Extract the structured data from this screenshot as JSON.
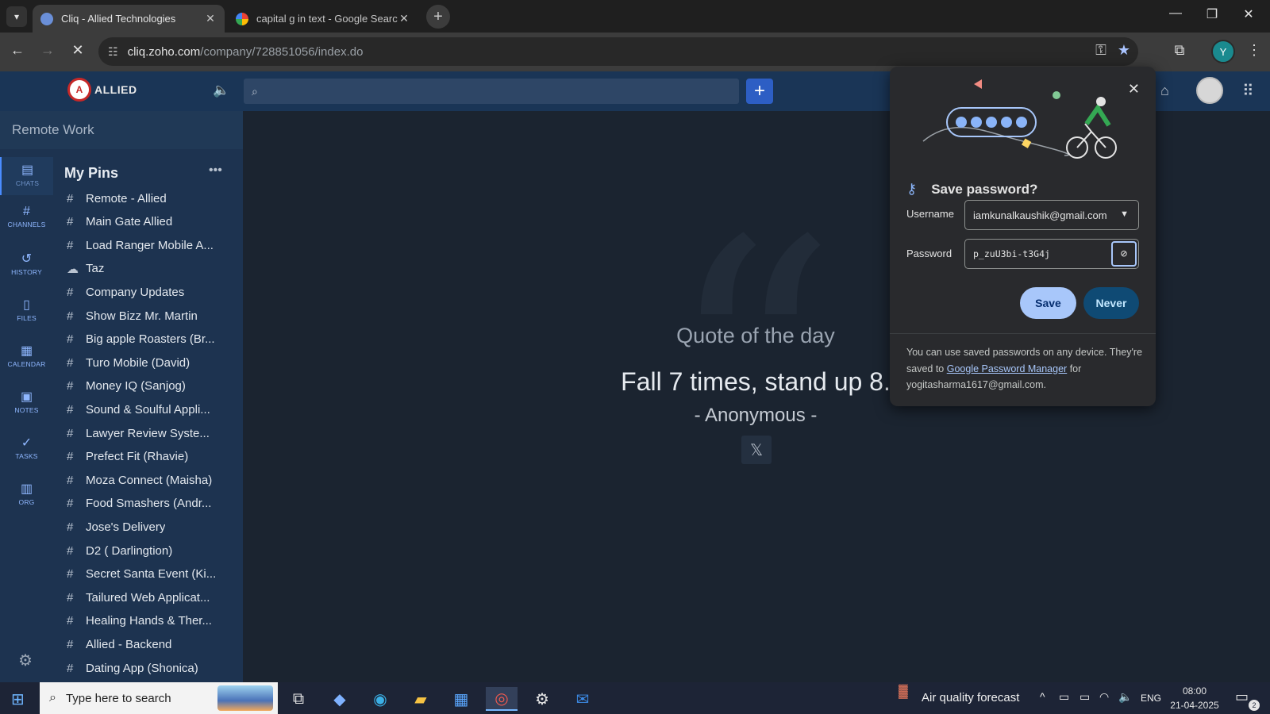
{
  "browser": {
    "tabs": [
      {
        "title": "Cliq - Allied Technologies",
        "active": true
      },
      {
        "title": "capital g in text - Google Search",
        "active": false
      }
    ],
    "url_host": "cliq.zoho.com",
    "url_path": "/company/728851056/index.do",
    "profile_initial": "Y"
  },
  "cliq": {
    "logo_text": "ALLIED",
    "org_name": "Remote Work",
    "rail": [
      {
        "label": "CHATS",
        "icon": "chat-icon"
      },
      {
        "label": "CHANNELS",
        "icon": "hash-icon"
      },
      {
        "label": "HISTORY",
        "icon": "history-icon"
      },
      {
        "label": "FILES",
        "icon": "file-icon"
      },
      {
        "label": "CALENDAR",
        "icon": "calendar-icon"
      },
      {
        "label": "NOTES",
        "icon": "notes-icon"
      },
      {
        "label": "TASKS",
        "icon": "tasks-icon"
      },
      {
        "label": "ORG",
        "icon": "org-icon"
      }
    ],
    "pins_title": "My Pins",
    "pins": [
      {
        "name": "Remote - Allied",
        "icon": "#"
      },
      {
        "name": "Main Gate Allied",
        "icon": "#"
      },
      {
        "name": "Load Ranger Mobile A...",
        "icon": "#"
      },
      {
        "name": "Taz",
        "icon": "cloud"
      },
      {
        "name": "Company Updates",
        "icon": "#"
      },
      {
        "name": "Show Bizz Mr. Martin",
        "icon": "#"
      },
      {
        "name": "Big apple Roasters (Br...",
        "icon": "#"
      },
      {
        "name": "Turo Mobile (David)",
        "icon": "#"
      },
      {
        "name": "Money IQ (Sanjog)",
        "icon": "#"
      },
      {
        "name": "Sound & Soulful Appli...",
        "icon": "#"
      },
      {
        "name": "Lawyer Review Syste...",
        "icon": "#"
      },
      {
        "name": "Prefect Fit (Rhavie)",
        "icon": "#"
      },
      {
        "name": "Moza Connect (Maisha)",
        "icon": "#"
      },
      {
        "name": "Food Smashers (Andr...",
        "icon": "#"
      },
      {
        "name": "Jose's Delivery",
        "icon": "#"
      },
      {
        "name": "D2 ( Darlingtion)",
        "icon": "#"
      },
      {
        "name": "Secret Santa Event (Ki...",
        "icon": "#"
      },
      {
        "name": "Tailured Web Applicat...",
        "icon": "#"
      },
      {
        "name": "Healing Hands & Ther...",
        "icon": "#"
      },
      {
        "name": "Allied - Backend",
        "icon": "#"
      },
      {
        "name": "Dating App (Shonica)",
        "icon": "#"
      }
    ],
    "quote": {
      "label": "Quote of the day",
      "text": "Fall 7 times, stand up 8.",
      "author": "- Anonymous -"
    }
  },
  "password_popup": {
    "title": "Save password?",
    "username_label": "Username",
    "username_value": "iamkunalkaushik@gmail.com",
    "password_label": "Password",
    "password_value": "p_zuU3bi-t3G4j",
    "save_label": "Save",
    "never_label": "Never",
    "footer_prefix": "You can use saved passwords on any device. They're saved to ",
    "footer_link": "Google Password Manager",
    "footer_suffix": " for yogitasharma1617@gmail.com."
  },
  "taskbar": {
    "search_placeholder": "Type here to search",
    "weather_text": "Air quality forecast",
    "language": "ENG",
    "time": "08:00",
    "date": "21-04-2025",
    "notification_count": "2"
  },
  "colors": {
    "accent": "#2d5ec4",
    "save_button": "#a8c7fa",
    "never_button": "#0f4a74",
    "rail_bg": "#1d3350"
  }
}
